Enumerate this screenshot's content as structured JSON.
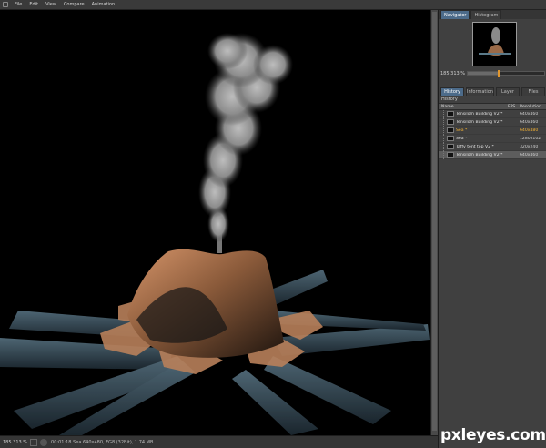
{
  "menubar": {
    "items": [
      "File",
      "Edit",
      "View",
      "Compare",
      "Animation"
    ]
  },
  "navigator": {
    "tabs": [
      "Navigator",
      "Histogram"
    ],
    "zoom": "185.313 %",
    "zoom_fraction": 0.4
  },
  "panel": {
    "tabs": [
      "History",
      "Information",
      "Layer",
      "Files"
    ],
    "history_label": "History",
    "columns": {
      "name": "Name",
      "fps": "FPS",
      "resolution": "Resolution"
    },
    "rows": [
      {
        "name": "Tensilom Building V2 *",
        "res": "640x460",
        "state": "normal"
      },
      {
        "name": "Tensilom Building V2 *",
        "res": "640x460",
        "state": "normal"
      },
      {
        "name": "Sea *",
        "res": "640x480",
        "state": "highlight"
      },
      {
        "name": "Sea *",
        "res": "1280x102",
        "state": "normal"
      },
      {
        "name": "Taffy tent top V2 *",
        "res": "320x240",
        "state": "normal"
      },
      {
        "name": "Tensilom Building V2 *",
        "res": "640x460",
        "state": "selected"
      }
    ]
  },
  "status": {
    "zoom": "185.313 %",
    "info": "00:01:18  Sea 640x480, FG8 (32Bit), 1.74 MB"
  },
  "watermark": "pxleyes.com",
  "colors": {
    "accent_tab": "#4c6b8a",
    "highlight_text": "#f4b233",
    "viewport_bg": "#000000"
  }
}
